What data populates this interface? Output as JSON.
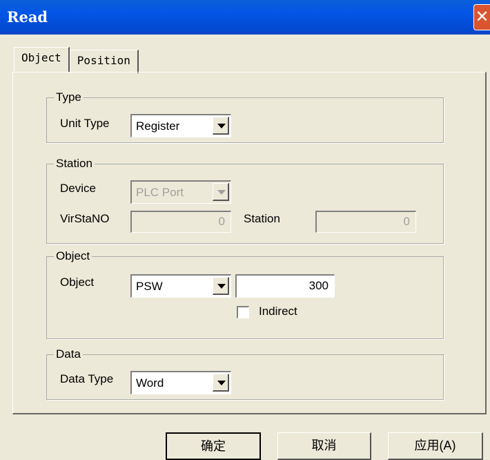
{
  "window": {
    "title": "Read",
    "close_glyph": "✕"
  },
  "tabs": [
    {
      "label": "Object"
    },
    {
      "label": "Position"
    }
  ],
  "type_group": {
    "title": "Type",
    "unit_type_label": "Unit Type",
    "unit_type_value": "Register"
  },
  "station_group": {
    "title": "Station",
    "device_label": "Device",
    "device_value": "PLC Port",
    "virstano_label": "VirStaNO",
    "virstano_value": "0",
    "station_label": "Station",
    "station_value": "0"
  },
  "object_group": {
    "title": "Object",
    "object_label": "Object",
    "object_value": "PSW",
    "address_value": "300",
    "indirect_label": "Indirect"
  },
  "data_group": {
    "title": "Data",
    "data_type_label": "Data Type",
    "data_type_value": "Word"
  },
  "buttons": {
    "ok": "确定",
    "cancel": "取消",
    "apply": "应用(A)"
  }
}
